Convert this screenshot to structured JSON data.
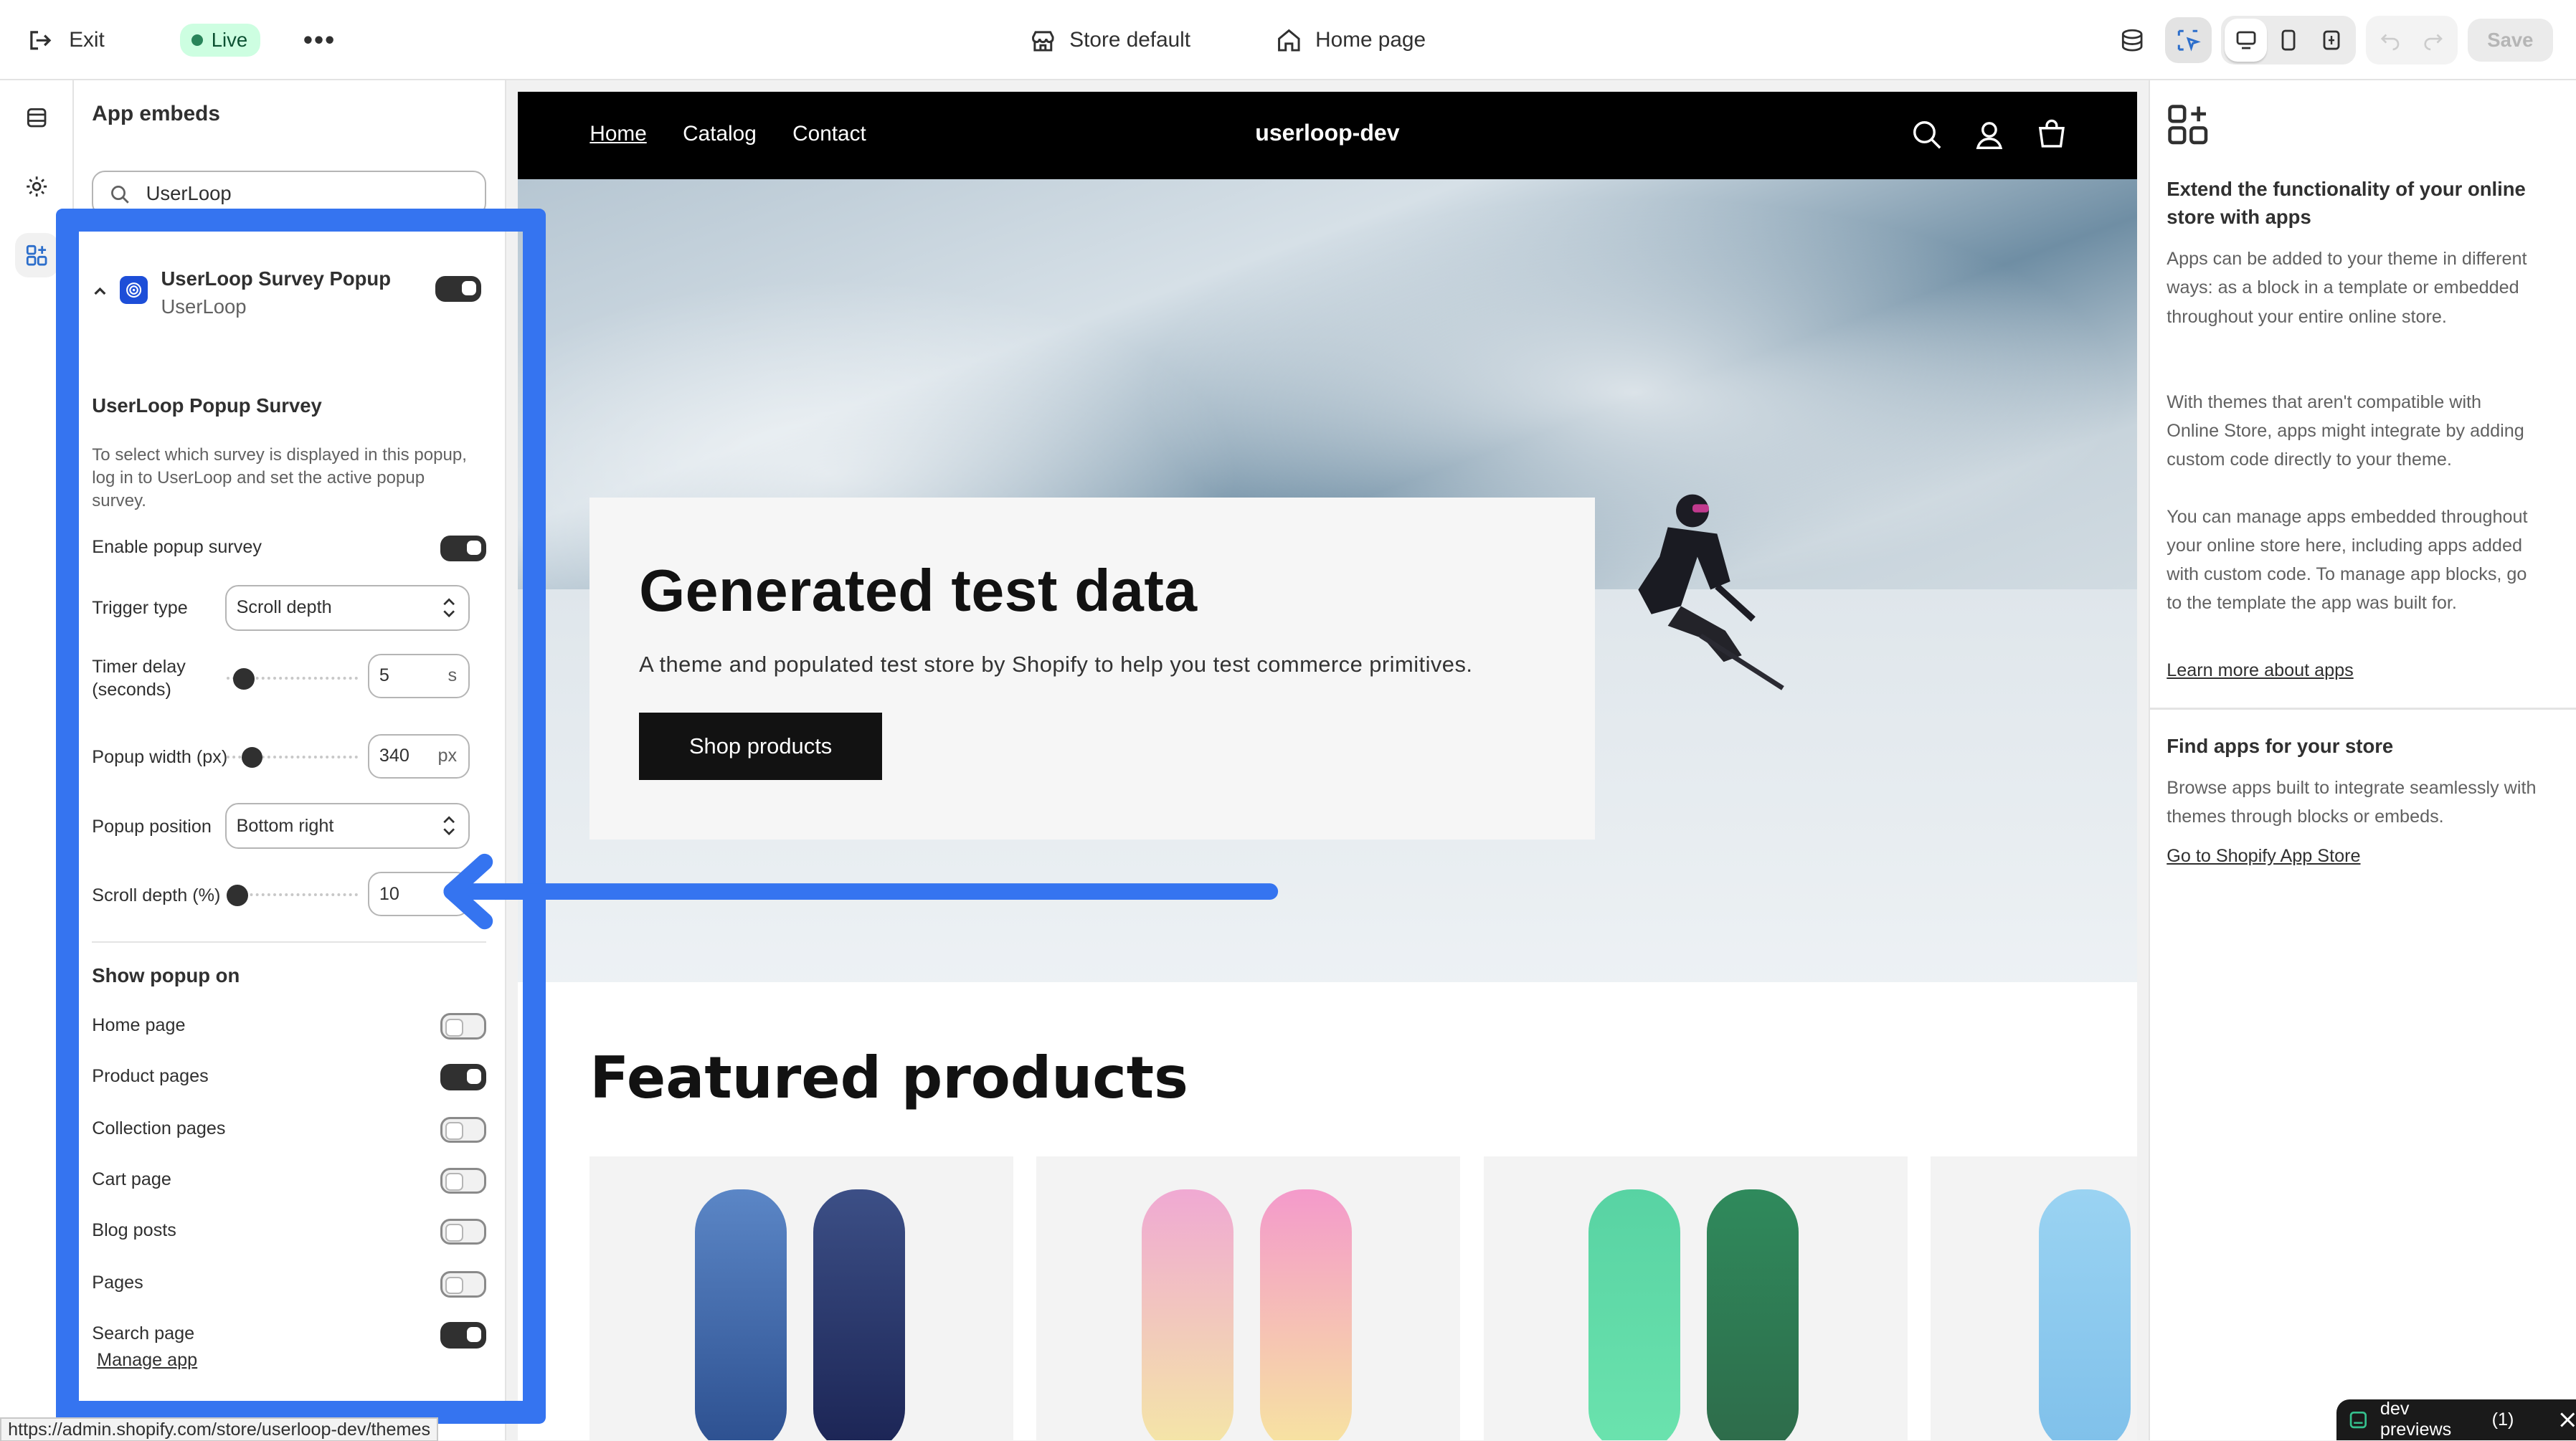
{
  "topbar": {
    "exit_label": "Exit",
    "live_label": "Live",
    "more_label": "•••",
    "store_label": "Store default",
    "page_label": "Home page",
    "save_label": "Save"
  },
  "left_panel": {
    "title": "App embeds",
    "search_value": "UserLoop",
    "embed": {
      "name": "UserLoop Survey Popup",
      "provider": "UserLoop",
      "enabled": true
    },
    "section_title": "UserLoop Popup Survey",
    "description": "To select which survey is displayed in this popup, log in to UserLoop and set the active popup survey.",
    "enable_label": "Enable popup survey",
    "trigger_label": "Trigger type",
    "trigger_value": "Scroll depth",
    "timer_label_1": "Timer delay",
    "timer_label_2": "(seconds)",
    "timer_value": "5",
    "timer_unit": "s",
    "width_label": "Popup width (px)",
    "width_value": "340",
    "width_unit": "px",
    "position_label": "Popup position",
    "position_value": "Bottom right",
    "scroll_label": "Scroll depth (%)",
    "scroll_value": "10",
    "show_title": "Show popup on",
    "show_options": [
      {
        "label": "Home page",
        "on": false
      },
      {
        "label": "Product pages",
        "on": true
      },
      {
        "label": "Collection pages",
        "on": false
      },
      {
        "label": "Cart page",
        "on": false
      },
      {
        "label": "Blog posts",
        "on": false
      },
      {
        "label": "Pages",
        "on": false
      },
      {
        "label": "Search page",
        "on": true
      }
    ],
    "manage_link": "Manage app"
  },
  "preview": {
    "nav_links": [
      "Home",
      "Catalog",
      "Contact"
    ],
    "brand": "userloop-dev",
    "hero_title": "Generated test data",
    "hero_text": "A theme and populated test store by Shopify to help you test commerce primitives.",
    "hero_button": "Shop products",
    "featured_title": "Featured products"
  },
  "right_panel": {
    "heading": "Extend the functionality of your online store with apps",
    "p1": "Apps can be added to your theme in different ways: as a block in a template or embedded throughout your entire online store.",
    "p2": "With themes that aren't compatible with Online Store, apps might integrate by adding custom code directly to your theme.",
    "p3": "You can manage apps embedded throughout your online store here, including apps added with custom code. To manage app blocks, go to the template the app was built for.",
    "learn_link": "Learn more about apps",
    "find_heading": "Find apps for your store",
    "find_text": "Browse apps built to integrate seamlessly with themes through blocks or embeds.",
    "store_link": "Go to Shopify App Store"
  },
  "status_url": "https://admin.shopify.com/store/userloop-dev/themes",
  "dev_previews": {
    "label": "dev previews",
    "count": "(1)"
  },
  "colors": {
    "accent_annotation": "#3574f0",
    "live_bg": "#cdfee1",
    "toggle_on": "#303030"
  }
}
